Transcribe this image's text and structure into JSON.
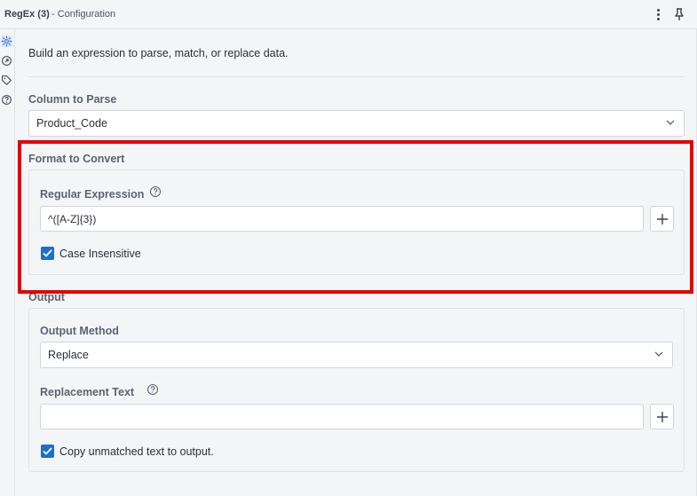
{
  "window": {
    "title": "RegEx (3)",
    "subtitle": "- Configuration"
  },
  "intro": "Build an expression to parse, match, or replace data.",
  "column_to_parse": {
    "label": "Column to Parse",
    "value": "Product_Code"
  },
  "format_to_convert": {
    "label": "Format to Convert",
    "regex_label": "Regular Expression",
    "regex_value": "^([A-Z]{3})",
    "case_insensitive_label": "Case Insensitive",
    "case_insensitive_checked": true
  },
  "output": {
    "label": "Output",
    "method_label": "Output Method",
    "method_value": "Replace",
    "replacement_label": "Replacement Text",
    "replacement_value": "",
    "copy_unmatched_label": "Copy unmatched text to output.",
    "copy_unmatched_checked": true
  },
  "colors": {
    "accent": "#1f6fc5",
    "highlight": "#e60000"
  },
  "icons": [
    "gear-icon",
    "arrow-icon",
    "tag-icon",
    "help-icon",
    "kebab-menu-icon",
    "pin-icon",
    "chevron-down-icon",
    "plus-icon",
    "checkmark-icon"
  ]
}
